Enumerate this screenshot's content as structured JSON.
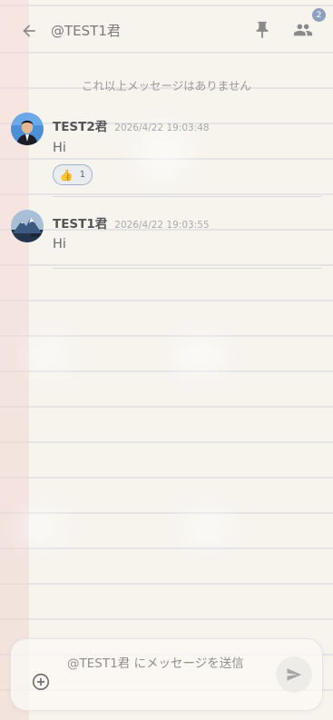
{
  "header": {
    "title": "@TEST1君",
    "members_badge": "2",
    "back_icon": "arrow-left-icon",
    "pin_icon": "pin-icon",
    "members_icon": "people-icon"
  },
  "notice": "これ以上メッセージはありません",
  "messages": [
    {
      "sender": "TEST2君",
      "time": "2026/4/22 19:03:48",
      "text": "Hi",
      "reaction": {
        "emoji": "👍",
        "count": "1"
      }
    },
    {
      "sender": "TEST1君",
      "time": "2026/4/22 19:03:55",
      "text": "Hi"
    }
  ],
  "composer": {
    "placeholder": "@TEST1君 にメッセージを送信",
    "add_icon": "plus-circle-icon",
    "send_icon": "send-icon"
  },
  "colors": {
    "paper": "#f4f0e7",
    "margin": "#f0b4b4",
    "badge": "#8ea0bf",
    "reaction_border": "#9fb0c8"
  }
}
